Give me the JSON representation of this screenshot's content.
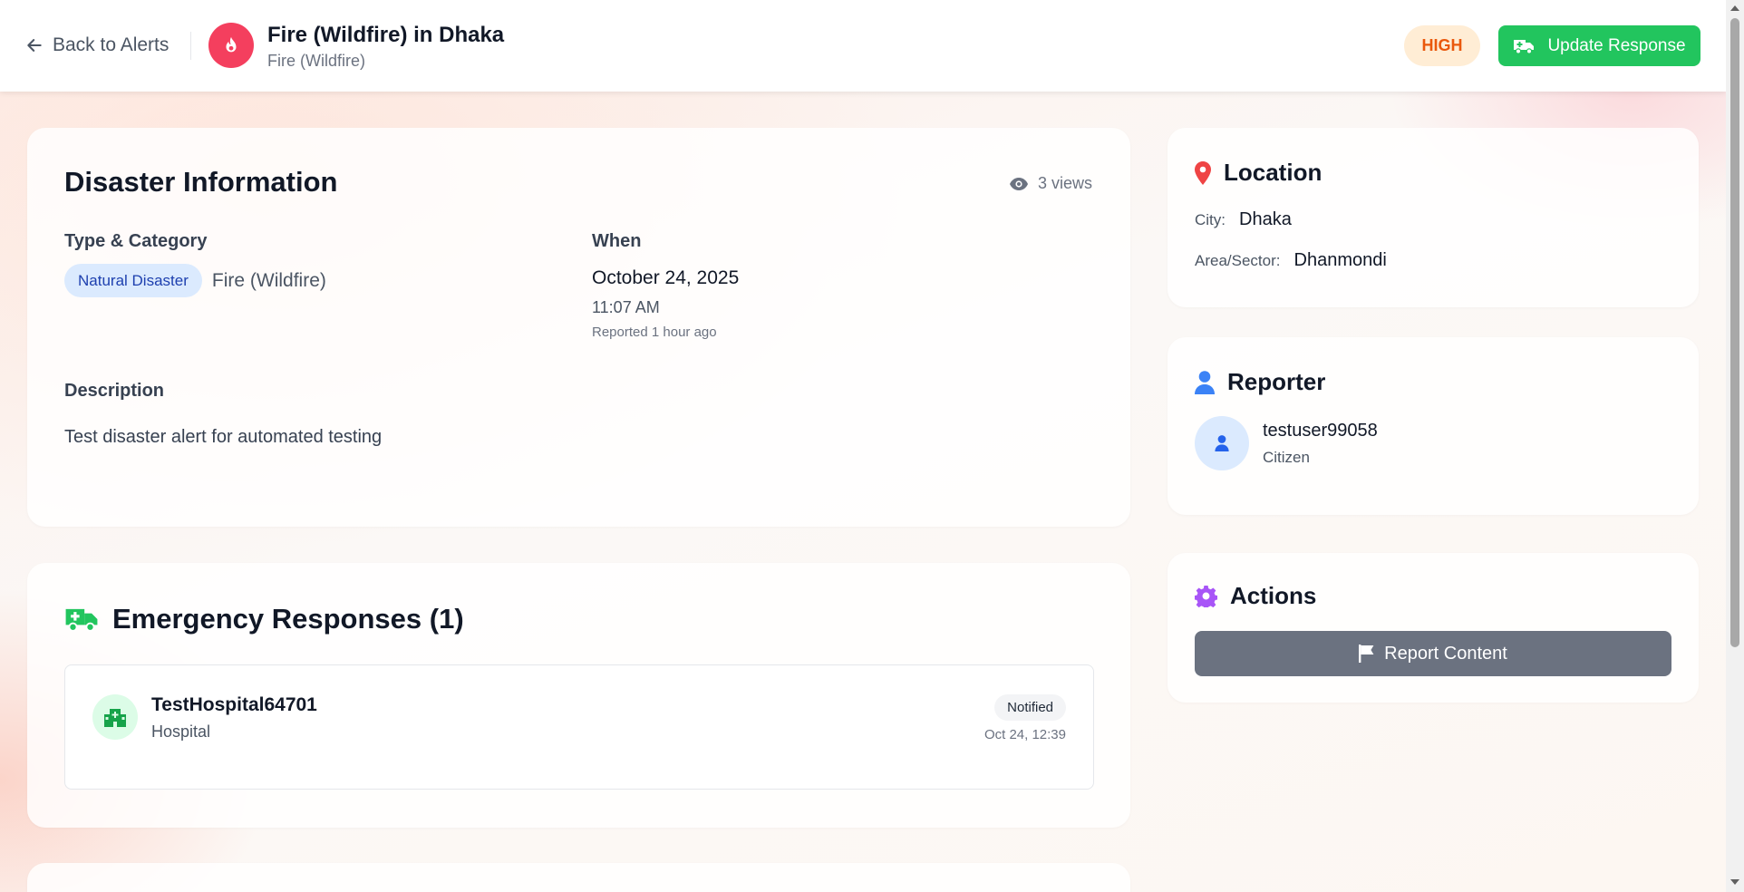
{
  "header": {
    "back_label": "Back to Alerts",
    "title": "Fire (Wildfire) in Dhaka",
    "subtitle": "Fire (Wildfire)",
    "severity": "HIGH",
    "update_button": "Update Response"
  },
  "info": {
    "heading": "Disaster Information",
    "views": "3 views",
    "type_label": "Type & Category",
    "type_chip": "Natural Disaster",
    "category": "Fire (Wildfire)",
    "when_label": "When",
    "date": "October 24, 2025",
    "time": "11:07 AM",
    "reported": "Reported 1 hour ago",
    "description_label": "Description",
    "description": "Test disaster alert for automated testing"
  },
  "responses": {
    "heading": "Emergency Responses (1)",
    "items": [
      {
        "name": "TestHospital64701",
        "type": "Hospital",
        "status": "Notified",
        "timestamp": "Oct 24, 12:39"
      }
    ]
  },
  "location": {
    "heading": "Location",
    "city_label": "City:",
    "city": "Dhaka",
    "area_label": "Area/Sector:",
    "area": "Dhanmondi"
  },
  "reporter": {
    "heading": "Reporter",
    "username": "testuser99058",
    "role": "Citizen"
  },
  "actions": {
    "heading": "Actions",
    "report_button": "Report Content"
  },
  "icons": {
    "back": "arrow-left-icon",
    "alert": "fire-icon",
    "update": "ambulance-icon",
    "views": "eye-icon",
    "responses": "ambulance-icon",
    "hospital": "hospital-icon",
    "location": "map-pin-icon",
    "reporter": "user-icon",
    "actions": "gear-icon",
    "report": "flag-icon"
  },
  "colors": {
    "alert_icon_bg": "#f43f5e",
    "severity_bg": "#ffedd5",
    "severity_text": "#ea580c",
    "primary_green": "#22c55e",
    "chip_bg": "#dbeafe",
    "chip_text": "#1e40af",
    "location_pin": "#ef4444",
    "reporter_icon": "#3b82f6",
    "actions_icon": "#a855f7",
    "report_button": "#6b7280"
  }
}
